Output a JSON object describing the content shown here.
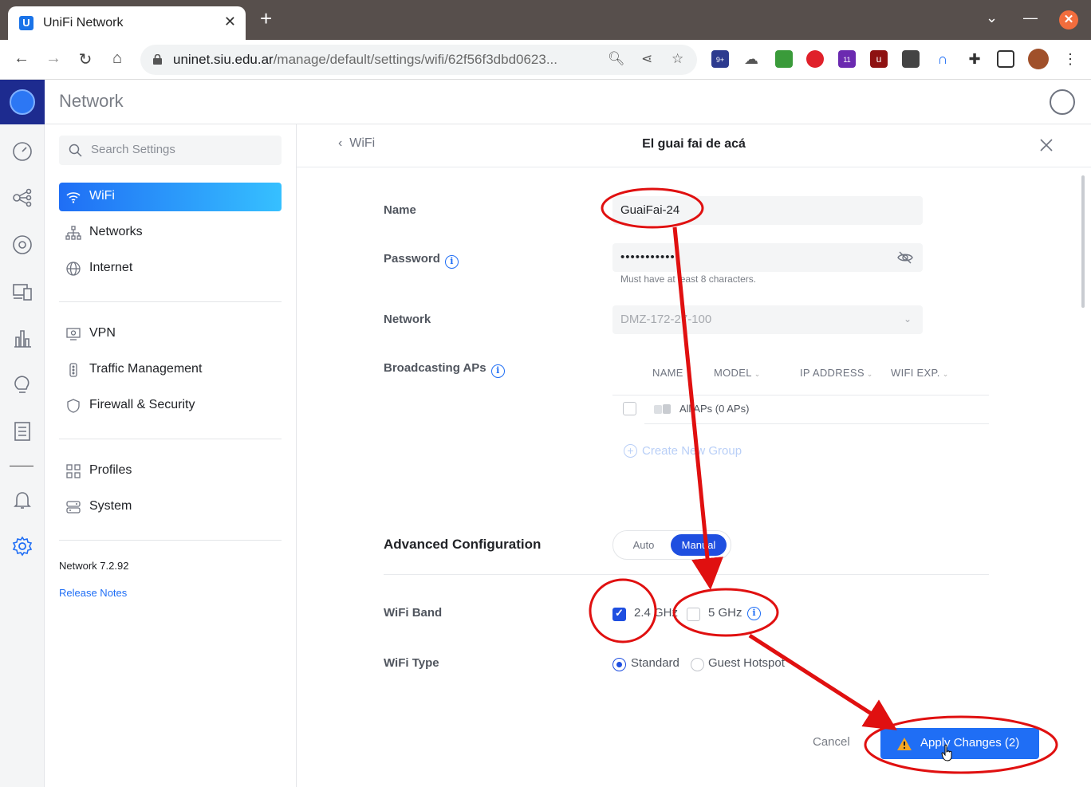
{
  "browser": {
    "tab_title": "UniFi Network",
    "url_host": "uninet.siu.edu.ar",
    "url_path": "/manage/default/settings/wifi/62f56f3dbd0623...",
    "badges": {
      "ext_1": "9+",
      "ext_4": "11"
    }
  },
  "app": {
    "title": "Network"
  },
  "settings_nav": {
    "search_placeholder": "Search Settings",
    "items": [
      {
        "label": "WiFi"
      },
      {
        "label": "Networks"
      },
      {
        "label": "Internet"
      },
      {
        "label": "VPN"
      },
      {
        "label": "Traffic Management"
      },
      {
        "label": "Firewall & Security"
      },
      {
        "label": "Profiles"
      },
      {
        "label": "System"
      }
    ],
    "version": "Network 7.2.92",
    "release_notes": "Release Notes"
  },
  "panel": {
    "back_label": "WiFi",
    "title": "El guai fai de acá",
    "name_label": "Name",
    "name_value": "GuaiFai-24",
    "password_label": "Password",
    "password_value": "••••••••••••",
    "password_hint": "Must have at least 8 characters.",
    "network_label": "Network",
    "network_value": "DMZ-172-27-100",
    "broadcasting_label": "Broadcasting APs",
    "table_headers": [
      "NAME",
      "MODEL",
      "IP ADDRESS",
      "WIFI EXP."
    ],
    "ap_row": "All APs (0 APs)",
    "create_group": "Create New Group",
    "advanced_title": "Advanced Configuration",
    "mode_auto": "Auto",
    "mode_manual": "Manual",
    "band_label": "WiFi Band",
    "band_24": "2.4 GHz",
    "band_5": "5 GHz",
    "type_label": "WiFi Type",
    "type_standard": "Standard",
    "type_guest": "Guest Hotspot",
    "cancel": "Cancel",
    "apply": "Apply Changes (2)"
  },
  "colors": {
    "accent": "#1f6ef5",
    "annotation": "#e01010"
  }
}
